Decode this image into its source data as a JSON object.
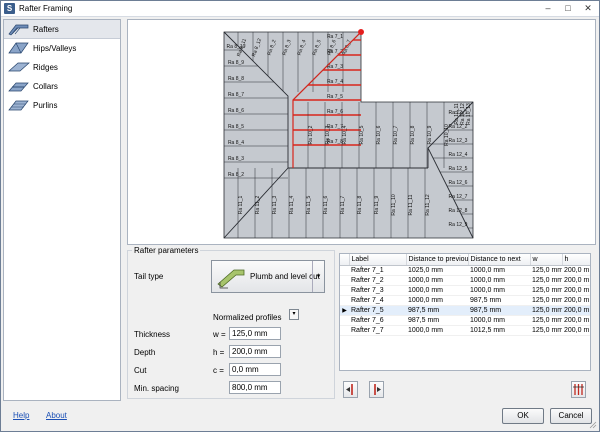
{
  "window": {
    "title": "Rafter Framing",
    "app_letter": "S"
  },
  "sidebar": {
    "items": [
      {
        "label": "Rafters",
        "icon": "rafters-icon",
        "active": true
      },
      {
        "label": "Hips/Valleys",
        "icon": "hips-valleys-icon",
        "active": false
      },
      {
        "label": "Ridges",
        "icon": "ridges-icon",
        "active": false
      },
      {
        "label": "Collars",
        "icon": "collars-icon",
        "active": false
      },
      {
        "label": "Purlins",
        "icon": "purlins-icon",
        "active": false
      }
    ]
  },
  "roof": {
    "labels_top_left": [
      "Ra 8_11",
      "Ra 8_12",
      "Ra 8_2",
      "Ra 8_3",
      "Ra 8_4",
      "Ra 8_5",
      "Ra 8_6",
      "Ra 8_7",
      "Ra 8_8",
      "Ra 8_9",
      "Ra 8_10"
    ],
    "labels_red": [
      "Ra 7_1",
      "Ra 7_2",
      "Ra 7_3",
      "Ra 7_4",
      "Ra 7_5",
      "Ra 7_6",
      "Ra 7_7",
      "Ra 7_8"
    ],
    "labels_left_column": [
      "Ra 8_10",
      "Ra 8_9",
      "Ra 8_8",
      "Ra 8_7",
      "Ra 8_6",
      "Ra 8_5",
      "Ra 8_4",
      "Ra 8_3",
      "Ra 8_2"
    ],
    "labels_right_column": [
      "Ra 12_1",
      "Ra 12_2",
      "Ra 12_3",
      "Ra 12_4",
      "Ra 12_5",
      "Ra 12_6",
      "Ra 12_7",
      "Ra 12_8",
      "Ra 12_9"
    ],
    "labels_top_right": [
      "Ra 10_11",
      "Ra 10_12",
      "Ra 10_13"
    ],
    "labels_mid_top": [
      "Ra 10_2",
      "Ra 10_3",
      "Ra 10_4",
      "Ra 10_5",
      "Ra 10_6",
      "Ra 10_7",
      "Ra 10_8",
      "Ra 10_9",
      "Ra 10_10"
    ],
    "labels_bottom": [
      "Ra 11_1",
      "Ra 11_2",
      "Ra 11_3",
      "Ra 11_4",
      "Ra 11_5",
      "Ra 11_6",
      "Ra 11_7",
      "Ra 11_8",
      "Ra 11_9",
      "Ra 11_10",
      "Ra 11_11",
      "Ra 11_12",
      "Ra 11_13"
    ],
    "selected_color": "#d9261c",
    "roof_color": "#c5c9cf",
    "line_color": "#2a2d33"
  },
  "params": {
    "legend": "Rafter parameters",
    "tail_type_label": "Tail type",
    "tail_type_value": "Plumb and level cut",
    "normalized_label": "Normalized profiles",
    "thickness_label": "Thickness",
    "thickness_sym": "w =",
    "thickness_value": "125,0 mm",
    "depth_label": "Depth",
    "depth_sym": "h =",
    "depth_value": "200,0 mm",
    "cut_label": "Cut",
    "cut_sym": "c =",
    "cut_value": "0,0 mm",
    "spacing_label": "Min. spacing",
    "spacing_value": "800,0 mm"
  },
  "grid": {
    "columns": [
      "Label",
      "Distance to previous",
      "Distance to next",
      "w",
      "h"
    ],
    "rows": [
      [
        "Rafter 7_1",
        "1025,0 mm",
        "1000,0 mm",
        "125,0 mm",
        "200,0 m"
      ],
      [
        "Rafter 7_2",
        "1000,0 mm",
        "1000,0 mm",
        "125,0 mm",
        "200,0 m"
      ],
      [
        "Rafter 7_3",
        "1000,0 mm",
        "1000,0 mm",
        "125,0 mm",
        "200,0 m"
      ],
      [
        "Rafter 7_4",
        "1000,0 mm",
        "987,5 mm",
        "125,0 mm",
        "200,0 m"
      ],
      [
        "Rafter 7_5",
        "987,5 mm",
        "987,5 mm",
        "125,0 mm",
        "200,0 m"
      ],
      [
        "Rafter 7_6",
        "987,5 mm",
        "1000,0 mm",
        "125,0 mm",
        "200,0 m"
      ],
      [
        "Rafter 7_7",
        "1000,0 mm",
        "1012,5 mm",
        "125,0 mm",
        "200,0 m"
      ]
    ],
    "selected_row": 4,
    "row_marker": "▶"
  },
  "footer": {
    "help": "Help",
    "about": "About",
    "ok": "OK",
    "cancel": "Cancel"
  }
}
